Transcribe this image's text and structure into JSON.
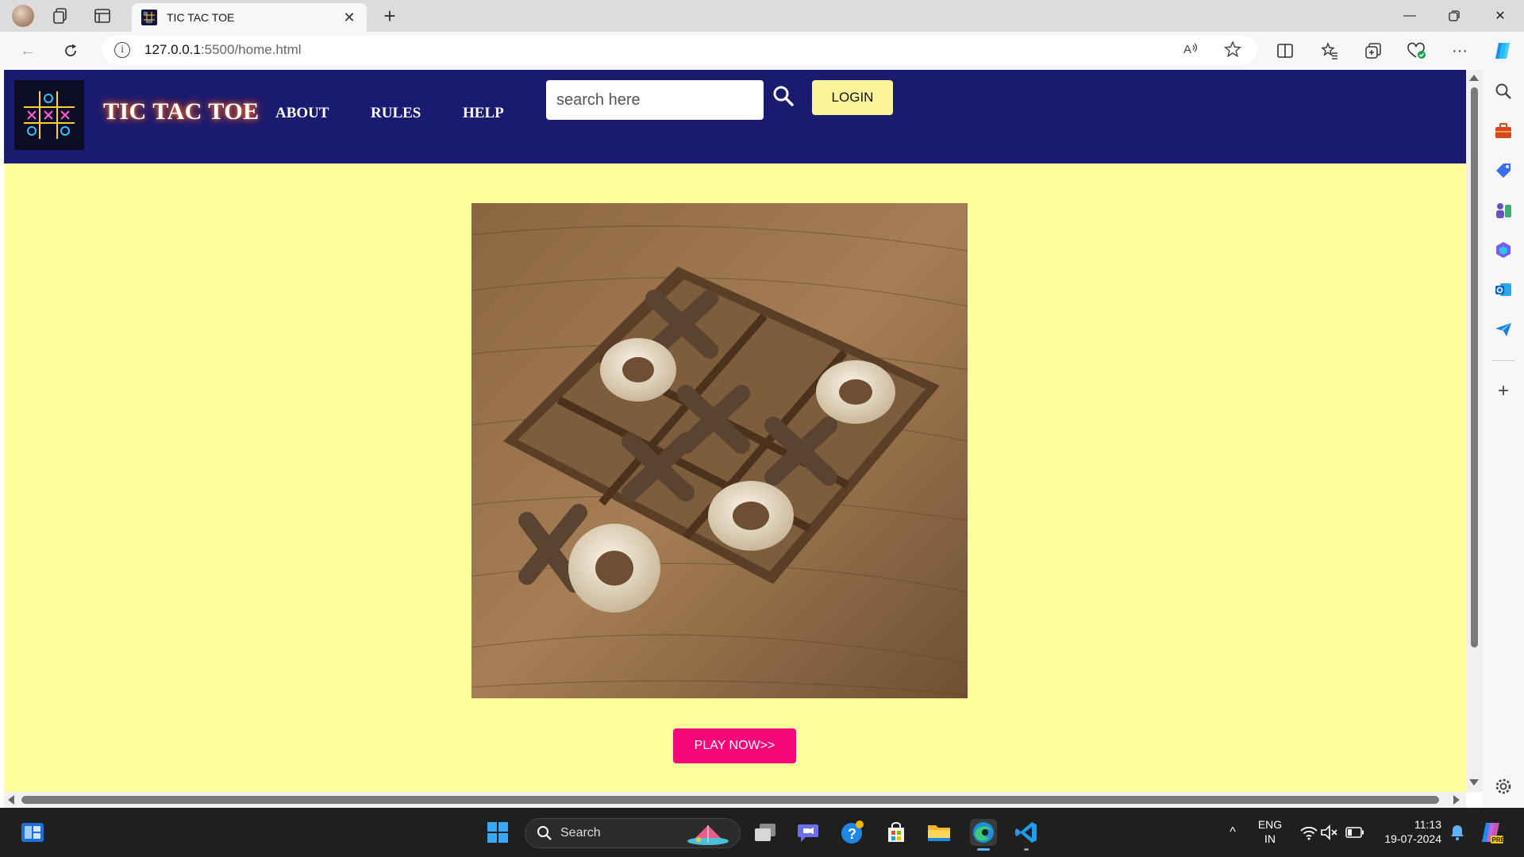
{
  "browser": {
    "tab_title": "TIC TAC TOE",
    "url_host": "127.0.0.1",
    "url_path": ":5500/home.html"
  },
  "site": {
    "title": "TIC TAC TOE",
    "nav": [
      {
        "label": "ABOUT"
      },
      {
        "label": "RULES"
      },
      {
        "label": "HELP"
      }
    ],
    "search_placeholder": "search here",
    "login_label": "LOGIN",
    "play_label": "PLAY NOW>>",
    "colors": {
      "header_bg": "#1a1a70",
      "page_bg": "#ffff9c",
      "login_bg": "#fbf59a",
      "play_bg": "#f7067a"
    }
  },
  "taskbar": {
    "search_label": "Search",
    "lang_line1": "ENG",
    "lang_line2": "IN",
    "time": "11:13",
    "date": "19-07-2024"
  }
}
